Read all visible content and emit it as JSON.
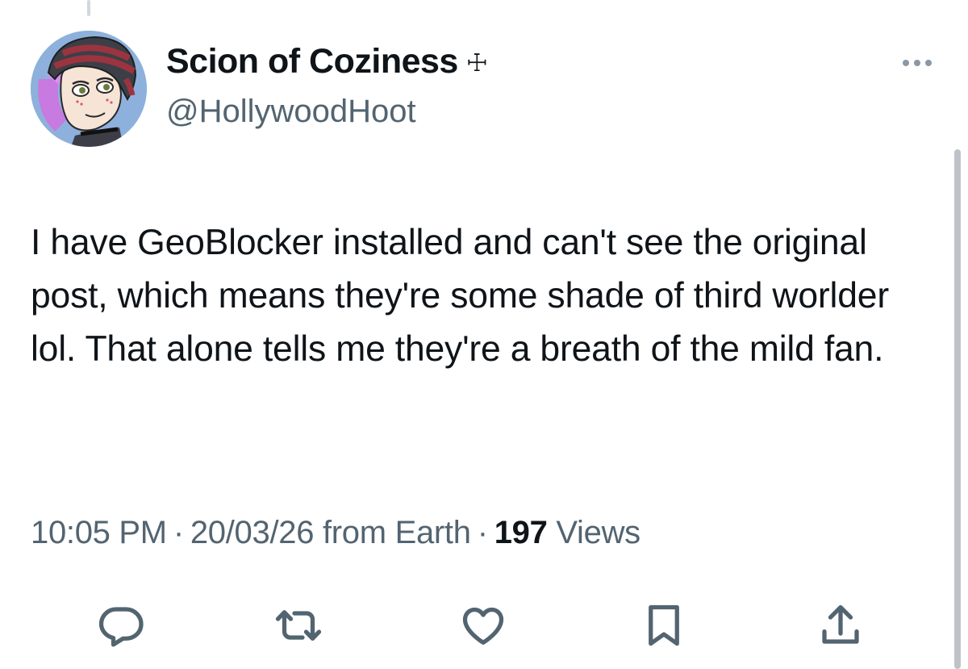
{
  "author": {
    "display_name": "Scion of Coziness",
    "name_glyph": "☩",
    "handle": "@HollywoodHoot",
    "avatar_icon": "cartoon-avatar-icon"
  },
  "tweet": {
    "text": "I have GeoBlocker installed and can't see the original post, which means they're some shade of third worlder lol. That alone tells me they're a breath of the mild fan."
  },
  "meta": {
    "time": "10:05 PM",
    "separator": "·",
    "date_location": "20/03/26 from Earth",
    "views_count": "197",
    "views_label": "Views"
  },
  "actions": [
    {
      "name": "reply",
      "icon": "reply-icon"
    },
    {
      "name": "retweet",
      "icon": "retweet-icon"
    },
    {
      "name": "like",
      "icon": "heart-icon"
    },
    {
      "name": "bookmark",
      "icon": "bookmark-icon"
    },
    {
      "name": "share",
      "icon": "share-icon"
    }
  ],
  "colors": {
    "text": "#0f1419",
    "secondary": "#536471",
    "icon": "#536471"
  }
}
